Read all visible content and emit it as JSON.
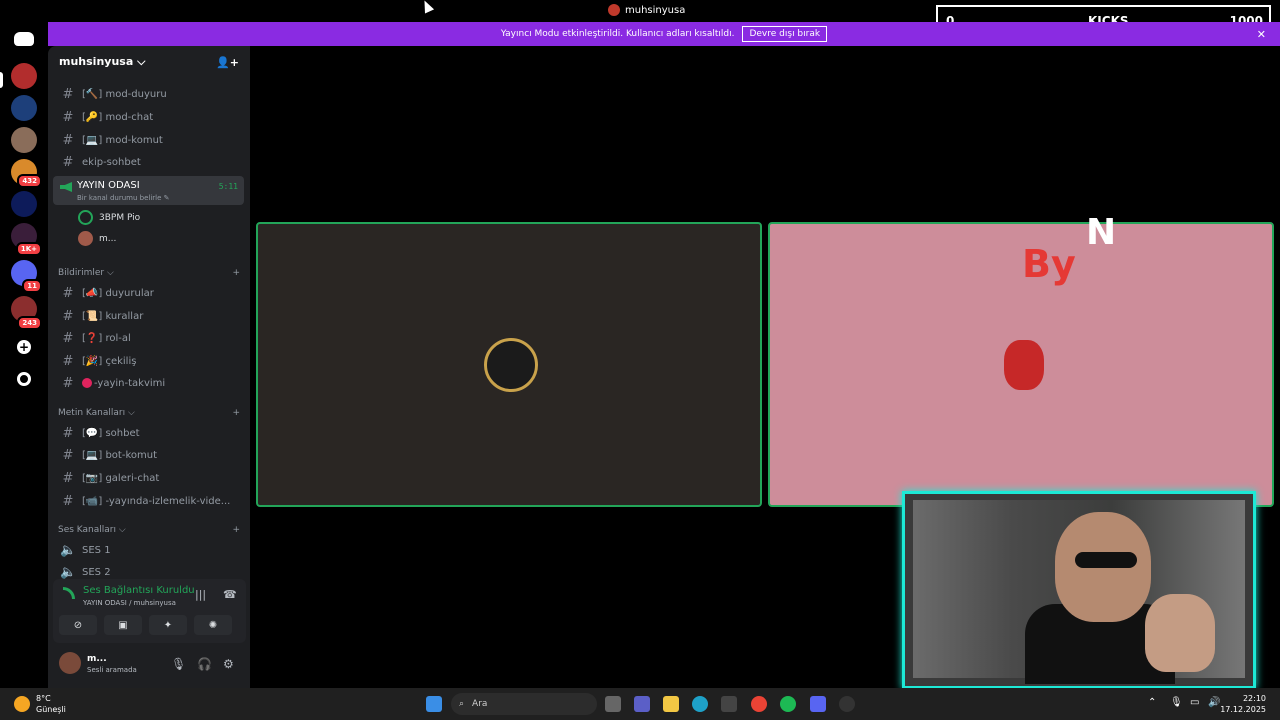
{
  "window": {
    "title": "muhsinyusa"
  },
  "overlay": {
    "left": "0",
    "center": "KICKS",
    "right": "1000"
  },
  "banner": {
    "message": "Yayıncı Modu etkinleştirildi. Kullanıcı adları kısaltıldı.",
    "button": "Devre dışı bırak",
    "close": "✕"
  },
  "rail": {
    "badges": [
      "432",
      "1K+",
      "11",
      "243"
    ],
    "discord_icon": "discord-icon",
    "add_icon": "plus-icon",
    "explore_icon": "compass-icon"
  },
  "guild": {
    "name": "muhsinyusa",
    "chevron": "⌵",
    "add_member_icon": "add-member-icon"
  },
  "channels_top": [
    {
      "label": "mod-duyuru",
      "emoji": "🔨"
    },
    {
      "label": "mod-chat",
      "emoji": "🔑"
    },
    {
      "label": "mod-komut",
      "emoji": "💻"
    }
  ],
  "ekip": {
    "label": "ekip-sohbet"
  },
  "voice_active": {
    "name": "YAYIN ODASI",
    "status": "Bir kanal durumu belirle ✎",
    "time": "5:11",
    "users": [
      "3BPM Pio",
      "m..."
    ]
  },
  "categories": {
    "bildirimler": "Bildirimler",
    "metin": "Metin Kanalları",
    "ses": "Ses Kanalları"
  },
  "bildirim_channels": [
    {
      "label": "duyurular",
      "emoji": "📣"
    },
    {
      "label": "kurallar",
      "emoji": "📜"
    },
    {
      "label": "rol-al",
      "emoji": "❓"
    },
    {
      "label": "çekiliş",
      "emoji": "🎉"
    }
  ],
  "takvim": {
    "label": "-yayin-takvimi"
  },
  "metin_channels": [
    {
      "label": "sohbet",
      "emoji": "💬"
    },
    {
      "label": "bot-komut",
      "emoji": "💻"
    },
    {
      "label": "galeri-chat",
      "emoji": "📷"
    },
    {
      "label": "-yayında-izlemelik-vide...",
      "emoji": "📹"
    }
  ],
  "ses_channels": [
    "SES 1",
    "SES 2"
  ],
  "voice_panel": {
    "title": "Ses Bağlantısı Kuruldu",
    "subtitle": "YAYIN ODASI / muhsinyusa"
  },
  "user": {
    "name": "m...",
    "status": "Sesli aramada"
  },
  "tile2": {
    "logo_text": "By",
    "logo_sup": "N"
  },
  "taskbar": {
    "temp": "8°C",
    "weather": "Güneşli",
    "search_placeholder": "Ara",
    "time": "22:10",
    "date": "17.12.2025"
  }
}
